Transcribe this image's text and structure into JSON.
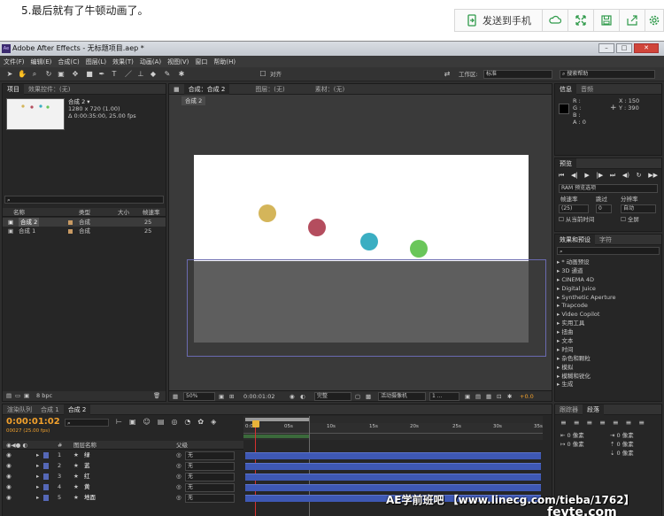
{
  "article": {
    "intro_text": "5.最后就有了牛顿动画了。",
    "share_label": "发送到手机"
  },
  "app": {
    "title": "Adobe After Effects - 无标题项目.aep *",
    "logo_text": "Ae",
    "menu": [
      "文件(F)",
      "编辑(E)",
      "合成(C)",
      "图层(L)",
      "效果(T)",
      "动画(A)",
      "视图(V)",
      "窗口",
      "帮助(H)"
    ],
    "align_label": "对齐",
    "workspace_label": "工作区:",
    "workspace_value": "标准",
    "search_help": "搜索帮助"
  },
  "project_panel": {
    "tabs": [
      "项目",
      "效果控件：(无)"
    ],
    "comp_name": "合成 2 ▾",
    "comp_size": "1280 x 720 (1.00)",
    "comp_duration": "Δ 0:00:35:00, 25.00 fps",
    "columns": [
      "名称",
      "类型",
      "大小",
      "帧速率"
    ],
    "items": [
      {
        "name": "合成 2",
        "type": "合成",
        "fps": "25"
      },
      {
        "name": "合成 1",
        "type": "合成",
        "fps": "25"
      }
    ],
    "bpc": "8 bpc"
  },
  "viewer": {
    "tabs": [
      "合成：合成 2",
      "图层：(无)",
      "素材：(无)"
    ],
    "breadcrumb": "合成 2",
    "zoom": "50%",
    "timecode": "0:00:01:02",
    "resolution": "完整",
    "camera": "活动摄像机",
    "views": "1 ...",
    "exposure": "+0.0"
  },
  "info_panel": {
    "tabs": [
      "信息",
      "音频"
    ],
    "r": "R :",
    "g": "G :",
    "b": "B :",
    "a": "A : 0",
    "x": "X : 150",
    "y": "Y : 390"
  },
  "preview_panel": {
    "tab": "预览",
    "ram_options": "RAM 预览选项",
    "frame_rate_label": "帧速率",
    "skip_label": "跳过",
    "resolution_label": "分辨率",
    "frame_rate_value": "(25)",
    "skip_value": "0",
    "resolution_value": "自动",
    "from_current": "从当前时间",
    "fullscreen": "全屏"
  },
  "effects_panel": {
    "tabs": [
      "效果和预设",
      "字符"
    ],
    "items": [
      "* 动画预设",
      "3D 通道",
      "CINEMA 4D",
      "Digital Juice",
      "Synthetic Aperture",
      "Trapcode",
      "Video Copilot",
      "实用工具",
      "扭曲",
      "文本",
      "时间",
      "杂色和颗粒",
      "模拟",
      "模糊和锐化",
      "生成"
    ]
  },
  "timeline": {
    "tabs": [
      "渲染队列",
      "合成 1",
      "合成 2"
    ],
    "timecode": "0:00:01:02",
    "frame_info": "00027 (25.00 fps)",
    "columns": [
      "#",
      "图层名称",
      "父级"
    ],
    "layers": [
      {
        "num": "1",
        "name": "绿",
        "parent": "无"
      },
      {
        "num": "2",
        "name": "蓝",
        "parent": "无"
      },
      {
        "num": "3",
        "name": "红",
        "parent": "无"
      },
      {
        "num": "4",
        "name": "黄",
        "parent": "无"
      },
      {
        "num": "5",
        "name": "地面",
        "parent": "无"
      }
    ],
    "ruler": [
      "0:00s",
      "05s",
      "10s",
      "15s",
      "20s",
      "25s",
      "30s",
      "35s"
    ]
  },
  "paragraph_panel": {
    "tabs": [
      "跟踪器",
      "段落"
    ],
    "px_label_1": "0 像素",
    "px_label_2": "0 像素",
    "px_label_3": "0 像素",
    "px_label_4": "0 像素",
    "px_label_5": "0 像素"
  },
  "watermark": {
    "text": "AE学前班吧 【www.linecg.com/tieba/1762】",
    "brand": "fevte.com"
  },
  "colors": {
    "ball_yellow": "#d4b55a",
    "ball_red": "#b44d5e",
    "ball_cyan": "#3aaec2",
    "ball_green": "#6ac65a",
    "layer_blue": "#3e58b4",
    "timecode_orange": "#f2a12c"
  }
}
